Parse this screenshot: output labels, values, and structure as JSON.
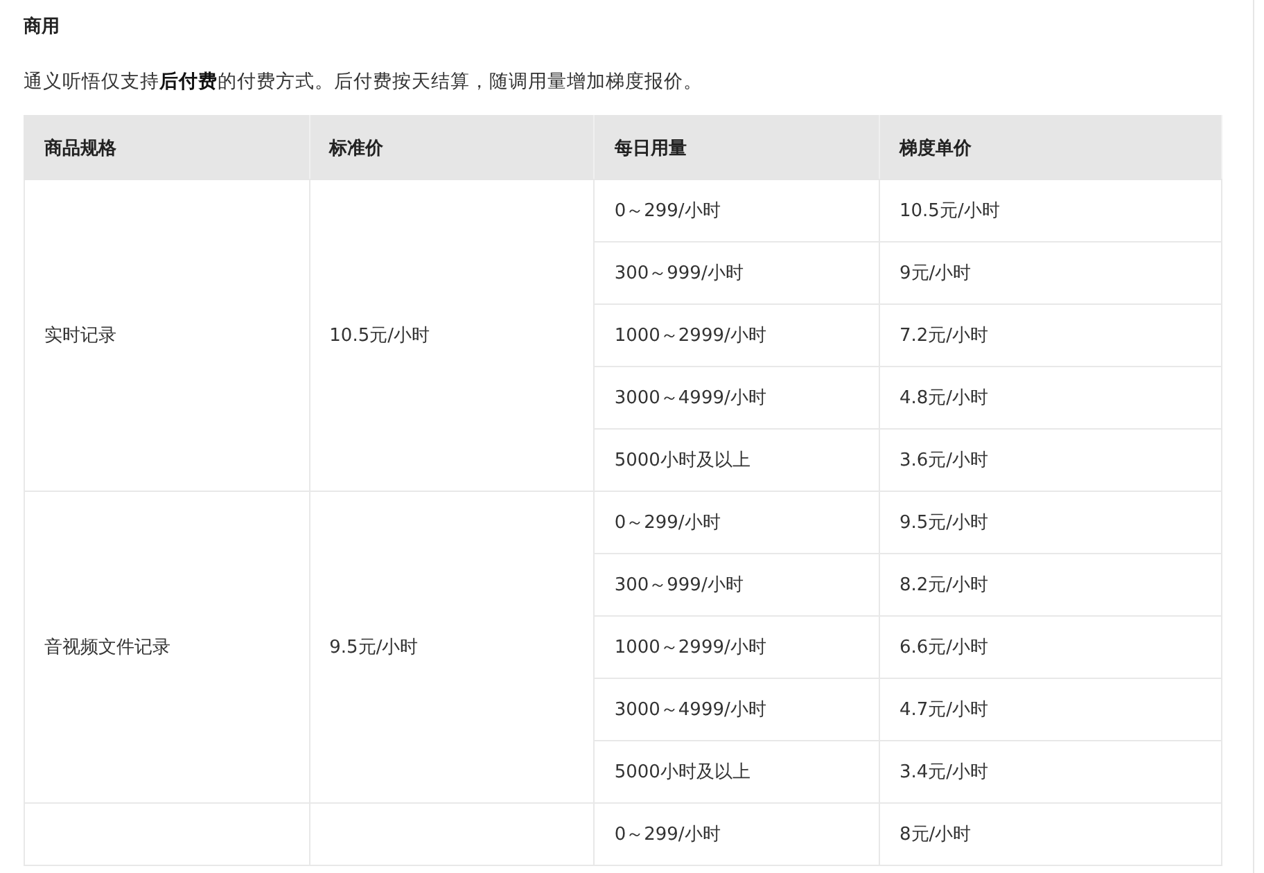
{
  "heading": "商用",
  "intro": "通义听悟仅支持**后付费**的付费方式。后付费按天结算，随调用量增加梯度报价。",
  "table": {
    "columns": [
      "商品规格",
      "标准价",
      "每日用量",
      "梯度单价"
    ],
    "groups": [
      {
        "product": "实时记录",
        "standard_price": "10.5元/小时",
        "tiers": [
          {
            "usage": "0～299/小时",
            "unit_price": "10.5元/小时"
          },
          {
            "usage": "300～999/小时",
            "unit_price": "9元/小时"
          },
          {
            "usage": "1000～2999/小时",
            "unit_price": "7.2元/小时"
          },
          {
            "usage": "3000～4999/小时",
            "unit_price": "4.8元/小时"
          },
          {
            "usage": "5000小时及以上",
            "unit_price": "3.6元/小时"
          }
        ]
      },
      {
        "product": "音视频文件记录",
        "standard_price": "9.5元/小时",
        "tiers": [
          {
            "usage": "0～299/小时",
            "unit_price": "9.5元/小时"
          },
          {
            "usage": "300～999/小时",
            "unit_price": "8.2元/小时"
          },
          {
            "usage": "1000～2999/小时",
            "unit_price": "6.6元/小时"
          },
          {
            "usage": "3000～4999/小时",
            "unit_price": "4.7元/小时"
          },
          {
            "usage": "5000小时及以上",
            "unit_price": "3.4元/小时"
          }
        ]
      },
      {
        "tiers": [
          {
            "usage": "0～299/小时",
            "unit_price": "8元/小时"
          }
        ]
      }
    ]
  }
}
